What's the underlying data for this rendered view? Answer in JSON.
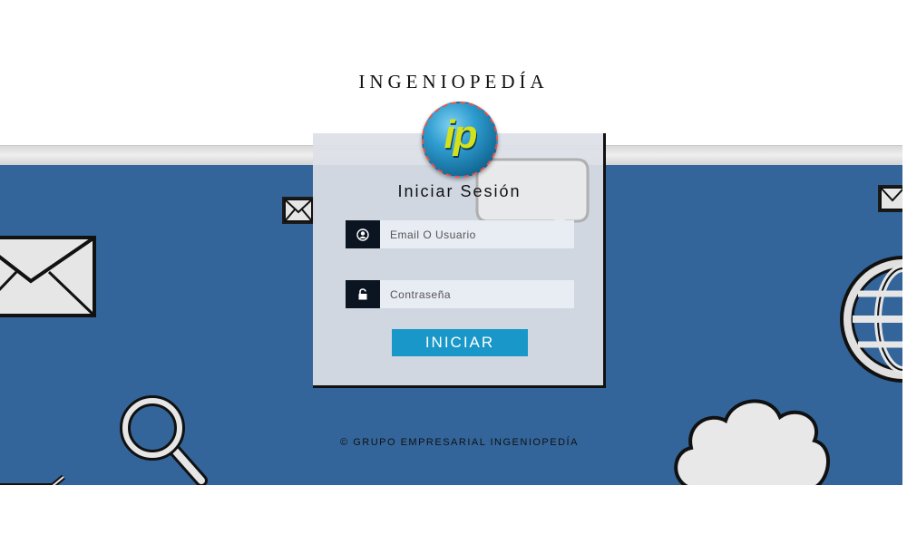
{
  "brand": {
    "name": "INGENIOPEDÍA"
  },
  "logo": {
    "text": "ip"
  },
  "login": {
    "title": "Iniciar Sesión",
    "user_placeholder": "Email O Usuario",
    "password_placeholder": "Contraseña",
    "submit_label": "INICIAR"
  },
  "footer": {
    "copyright": "© GRUPO EMPRESARIAL INGENIOPEDÍA"
  },
  "icons": {
    "user": "user-circle-icon",
    "password": "padlock-icon",
    "background": [
      "envelope-icon",
      "magnifier-icon",
      "globe-icon",
      "cloud-icon",
      "speech-bubble-icon"
    ]
  },
  "colors": {
    "banner": "#33659b",
    "button": "#1a97c9",
    "logo_letters": "#d4e21b",
    "field_icon_bg": "#0b1522"
  }
}
